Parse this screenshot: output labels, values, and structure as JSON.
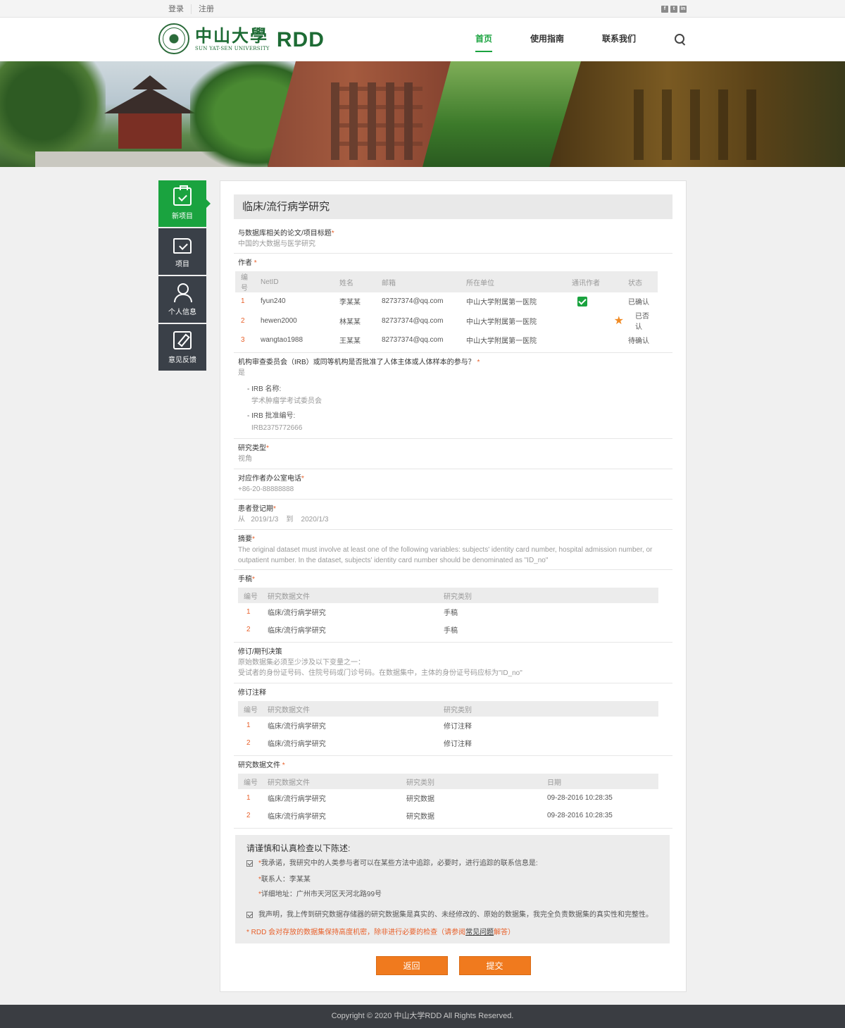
{
  "topbar": {
    "login": "登录",
    "register": "注册",
    "social": [
      "f",
      "t",
      "in"
    ]
  },
  "header": {
    "logo_cn": "中山大學",
    "logo_en": "SUN YAT-SEN UNIVERSITY",
    "logo_rdd": "RDD",
    "nav": [
      "首页",
      "使用指南",
      "联系我们"
    ]
  },
  "sidebar": {
    "items": [
      "新项目",
      "项目",
      "个人信息",
      "意见反馈"
    ]
  },
  "page_title": "临床/流行病学研究",
  "fields": {
    "paper_title_label": "与数据库相关的论文/项目标题",
    "paper_title_value": "中国的大数据与医学研究",
    "authors_label": "作者",
    "irb_label": "机构审查委员会（IRB）或同等机构是否批准了人体主体或人体样本的参与？",
    "irb_value": "是",
    "irb_name_label": "- IRB 名称:",
    "irb_name_value": "学术肿瘤学考试委员会",
    "irb_no_label": "- IRB 批准编号:",
    "irb_no_value": "IRB2375772666",
    "study_type_label": "研究类型",
    "study_type_value": "视角",
    "phone_label": "对应作者办公室电话",
    "phone_value": "+86-20-88888888",
    "period_label": "患者登记期",
    "period_from": "从",
    "period_start": "2019/1/3",
    "period_to": "到",
    "period_end": "2020/1/3",
    "abstract_label": "摘要",
    "abstract_value": "The original dataset must involve at least one of the following variables: subjects'   identity card number, hospital admission number, or outpatient number. In the dataset, subjects'   identity card number should be denominated as  \"ID_no\"",
    "manuscript_label": "手稿",
    "revision_label": "修订/期刊决策",
    "revision_value_1": "原始数据集必须至少涉及以下变量之一：",
    "revision_value_2": "受试者的身份证号码、住院号码或门诊号码。在数据集中，主体的身份证号码应标为\"ID_no\"",
    "revision_notes_label": "修订注释",
    "data_files_label": "研究数据文件"
  },
  "authors_table": {
    "headers": [
      "编号",
      "NetID",
      "姓名",
      "邮箱",
      "所在单位",
      "通讯作者",
      "状态"
    ],
    "rows": [
      {
        "no": "1",
        "netid": "fyun240",
        "name": "李某某",
        "email": "82737374@qq.com",
        "org": "中山大学附属第一医院",
        "corr": "check",
        "status": "已确认"
      },
      {
        "no": "2",
        "netid": "hewen2000",
        "name": "林某某",
        "email": "82737374@qq.com",
        "org": "中山大学附属第一医院",
        "corr": "star",
        "status": "已否认"
      },
      {
        "no": "3",
        "netid": "wangtao1988",
        "name": "王某某",
        "email": "82737374@qq.com",
        "org": "中山大学附属第一医院",
        "corr": "",
        "status": "待确认"
      }
    ]
  },
  "manuscript_table": {
    "headers": [
      "编号",
      "研究数据文件",
      "研究类别"
    ],
    "rows": [
      {
        "no": "1",
        "file": "临床/流行病学研究",
        "type": "手稿"
      },
      {
        "no": "2",
        "file": "临床/流行病学研究",
        "type": "手稿"
      }
    ]
  },
  "revision_table": {
    "headers": [
      "编号",
      "研究数据文件",
      "研究类别"
    ],
    "rows": [
      {
        "no": "1",
        "file": "临床/流行病学研究",
        "type": "修订注释"
      },
      {
        "no": "2",
        "file": "临床/流行病学研究",
        "type": "修订注释"
      }
    ]
  },
  "data_table": {
    "headers": [
      "编号",
      "研究数据文件",
      "研究类别",
      "日期"
    ],
    "rows": [
      {
        "no": "1",
        "file": "临床/流行病学研究",
        "type": "研究数据",
        "date": "09-28-2016 10:28:35"
      },
      {
        "no": "2",
        "file": "临床/流行病学研究",
        "type": "研究数据",
        "date": "09-28-2016 10:28:35"
      }
    ]
  },
  "notice": {
    "title": "请谨慎和认真检查以下陈述:",
    "pledge": "我承诺，我研究中的人类参与者可以在某些方法中追踪，必要时，进行追踪的联系信息是:",
    "contact_label": "联系人：李某某",
    "address_label": "详细地址：广州市天河区天河北路99号",
    "declare": "我声明，我上传到研究数据存储器的研究数据集是真实的、未经修改的、原始的数据集，我完全负责数据集的真实性和完整性。",
    "note_prefix": "*  RDD 会对存放的数据集保持高度机密，除非进行必要的检查（请参阅",
    "note_link": "常见问题",
    "note_suffix": "解答）"
  },
  "buttons": {
    "back": "返回",
    "submit": "提交"
  },
  "footer": "Copyright © 2020 中山大学RDD All Rights Reserved.",
  "colors": {
    "brand_green": "#1aa33f",
    "accent_orange": "#f07a1e",
    "sidebar_dark": "#3a4048"
  }
}
